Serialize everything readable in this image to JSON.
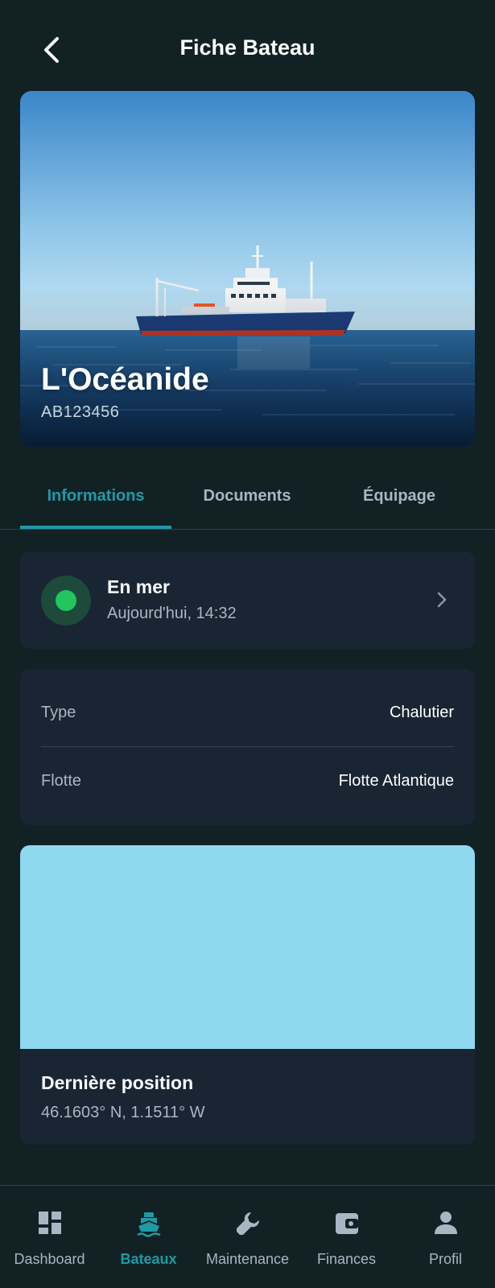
{
  "header": {
    "title": "Fiche Bateau"
  },
  "boat": {
    "name": "L'Océanide",
    "registration": "AB123456"
  },
  "tabs": [
    {
      "label": "Informations",
      "active": true
    },
    {
      "label": "Documents",
      "active": false
    },
    {
      "label": "Équipage",
      "active": false
    }
  ],
  "status": {
    "title": "En mer",
    "time": "Aujourd'hui, 14:32",
    "color": "#22c55e"
  },
  "details": [
    {
      "label": "Type",
      "value": "Chalutier"
    },
    {
      "label": "Flotte",
      "value": "Flotte Atlantique"
    }
  ],
  "position": {
    "title": "Dernière position",
    "coords": "46.1603° N, 1.1511° W"
  },
  "nav": [
    {
      "label": "Dashboard",
      "icon": "dashboard-icon",
      "active": false
    },
    {
      "label": "Bateaux",
      "icon": "boat-icon",
      "active": true
    },
    {
      "label": "Maintenance",
      "icon": "wrench-icon",
      "active": false
    },
    {
      "label": "Finances",
      "icon": "wallet-icon",
      "active": false
    },
    {
      "label": "Profil",
      "icon": "person-icon",
      "active": false
    }
  ],
  "colors": {
    "accent": "#1f9aa6",
    "background": "#112124",
    "card": "#192532",
    "map": "#8fd9ee"
  }
}
